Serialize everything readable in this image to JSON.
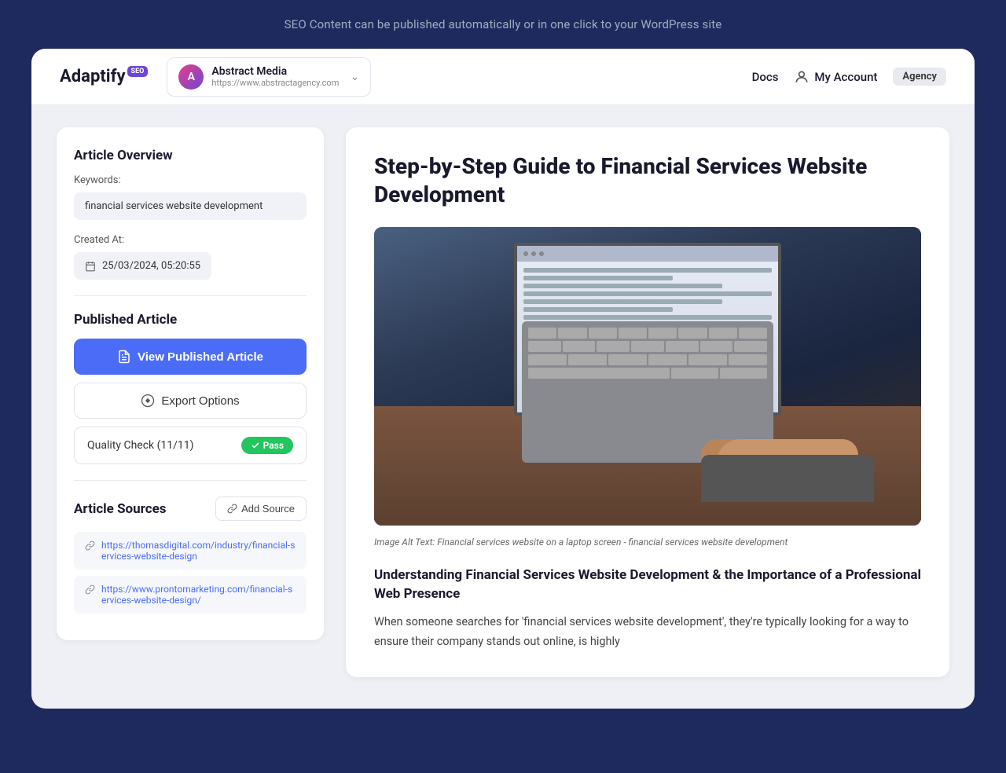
{
  "banner": {
    "text": "SEO Content can be published automatically or in one click to your WordPress site"
  },
  "header": {
    "logo_text": "Adaptify",
    "logo_badge": "SEO",
    "account": {
      "name": "Abstract Media",
      "url": "https://www.abstractagency.com"
    },
    "docs_label": "Docs",
    "my_account_label": "My Account",
    "agency_label": "Agency"
  },
  "left_panel": {
    "article_overview_title": "Article Overview",
    "keywords_label": "Keywords:",
    "keywords_value": "financial services website development",
    "created_at_label": "Created At:",
    "created_at_value": "25/03/2024, 05:20:55",
    "published_article_title": "Published Article",
    "view_published_btn": "View Published Article",
    "export_options_btn": "Export Options",
    "quality_check_label": "Quality Check (11/11)",
    "quality_pass_label": "Pass",
    "article_sources_title": "Article Sources",
    "add_source_btn": "Add Source",
    "sources": [
      "https://thomasdigital.com/industry/financial-services-website-design",
      "https://www.prontomarketing.com/financial-services-website-design/"
    ]
  },
  "right_panel": {
    "article_title": "Step-by-Step Guide to Financial Services Website Development",
    "image_caption": "Image Alt Text: Financial services website on a laptop screen - financial services website development",
    "section_title": "Understanding Financial Services Website Development & the Importance of a Professional Web Presence",
    "body_text": "When someone searches for 'financial services website development', they're typically looking for a way to ensure their company stands out online, is highly"
  }
}
